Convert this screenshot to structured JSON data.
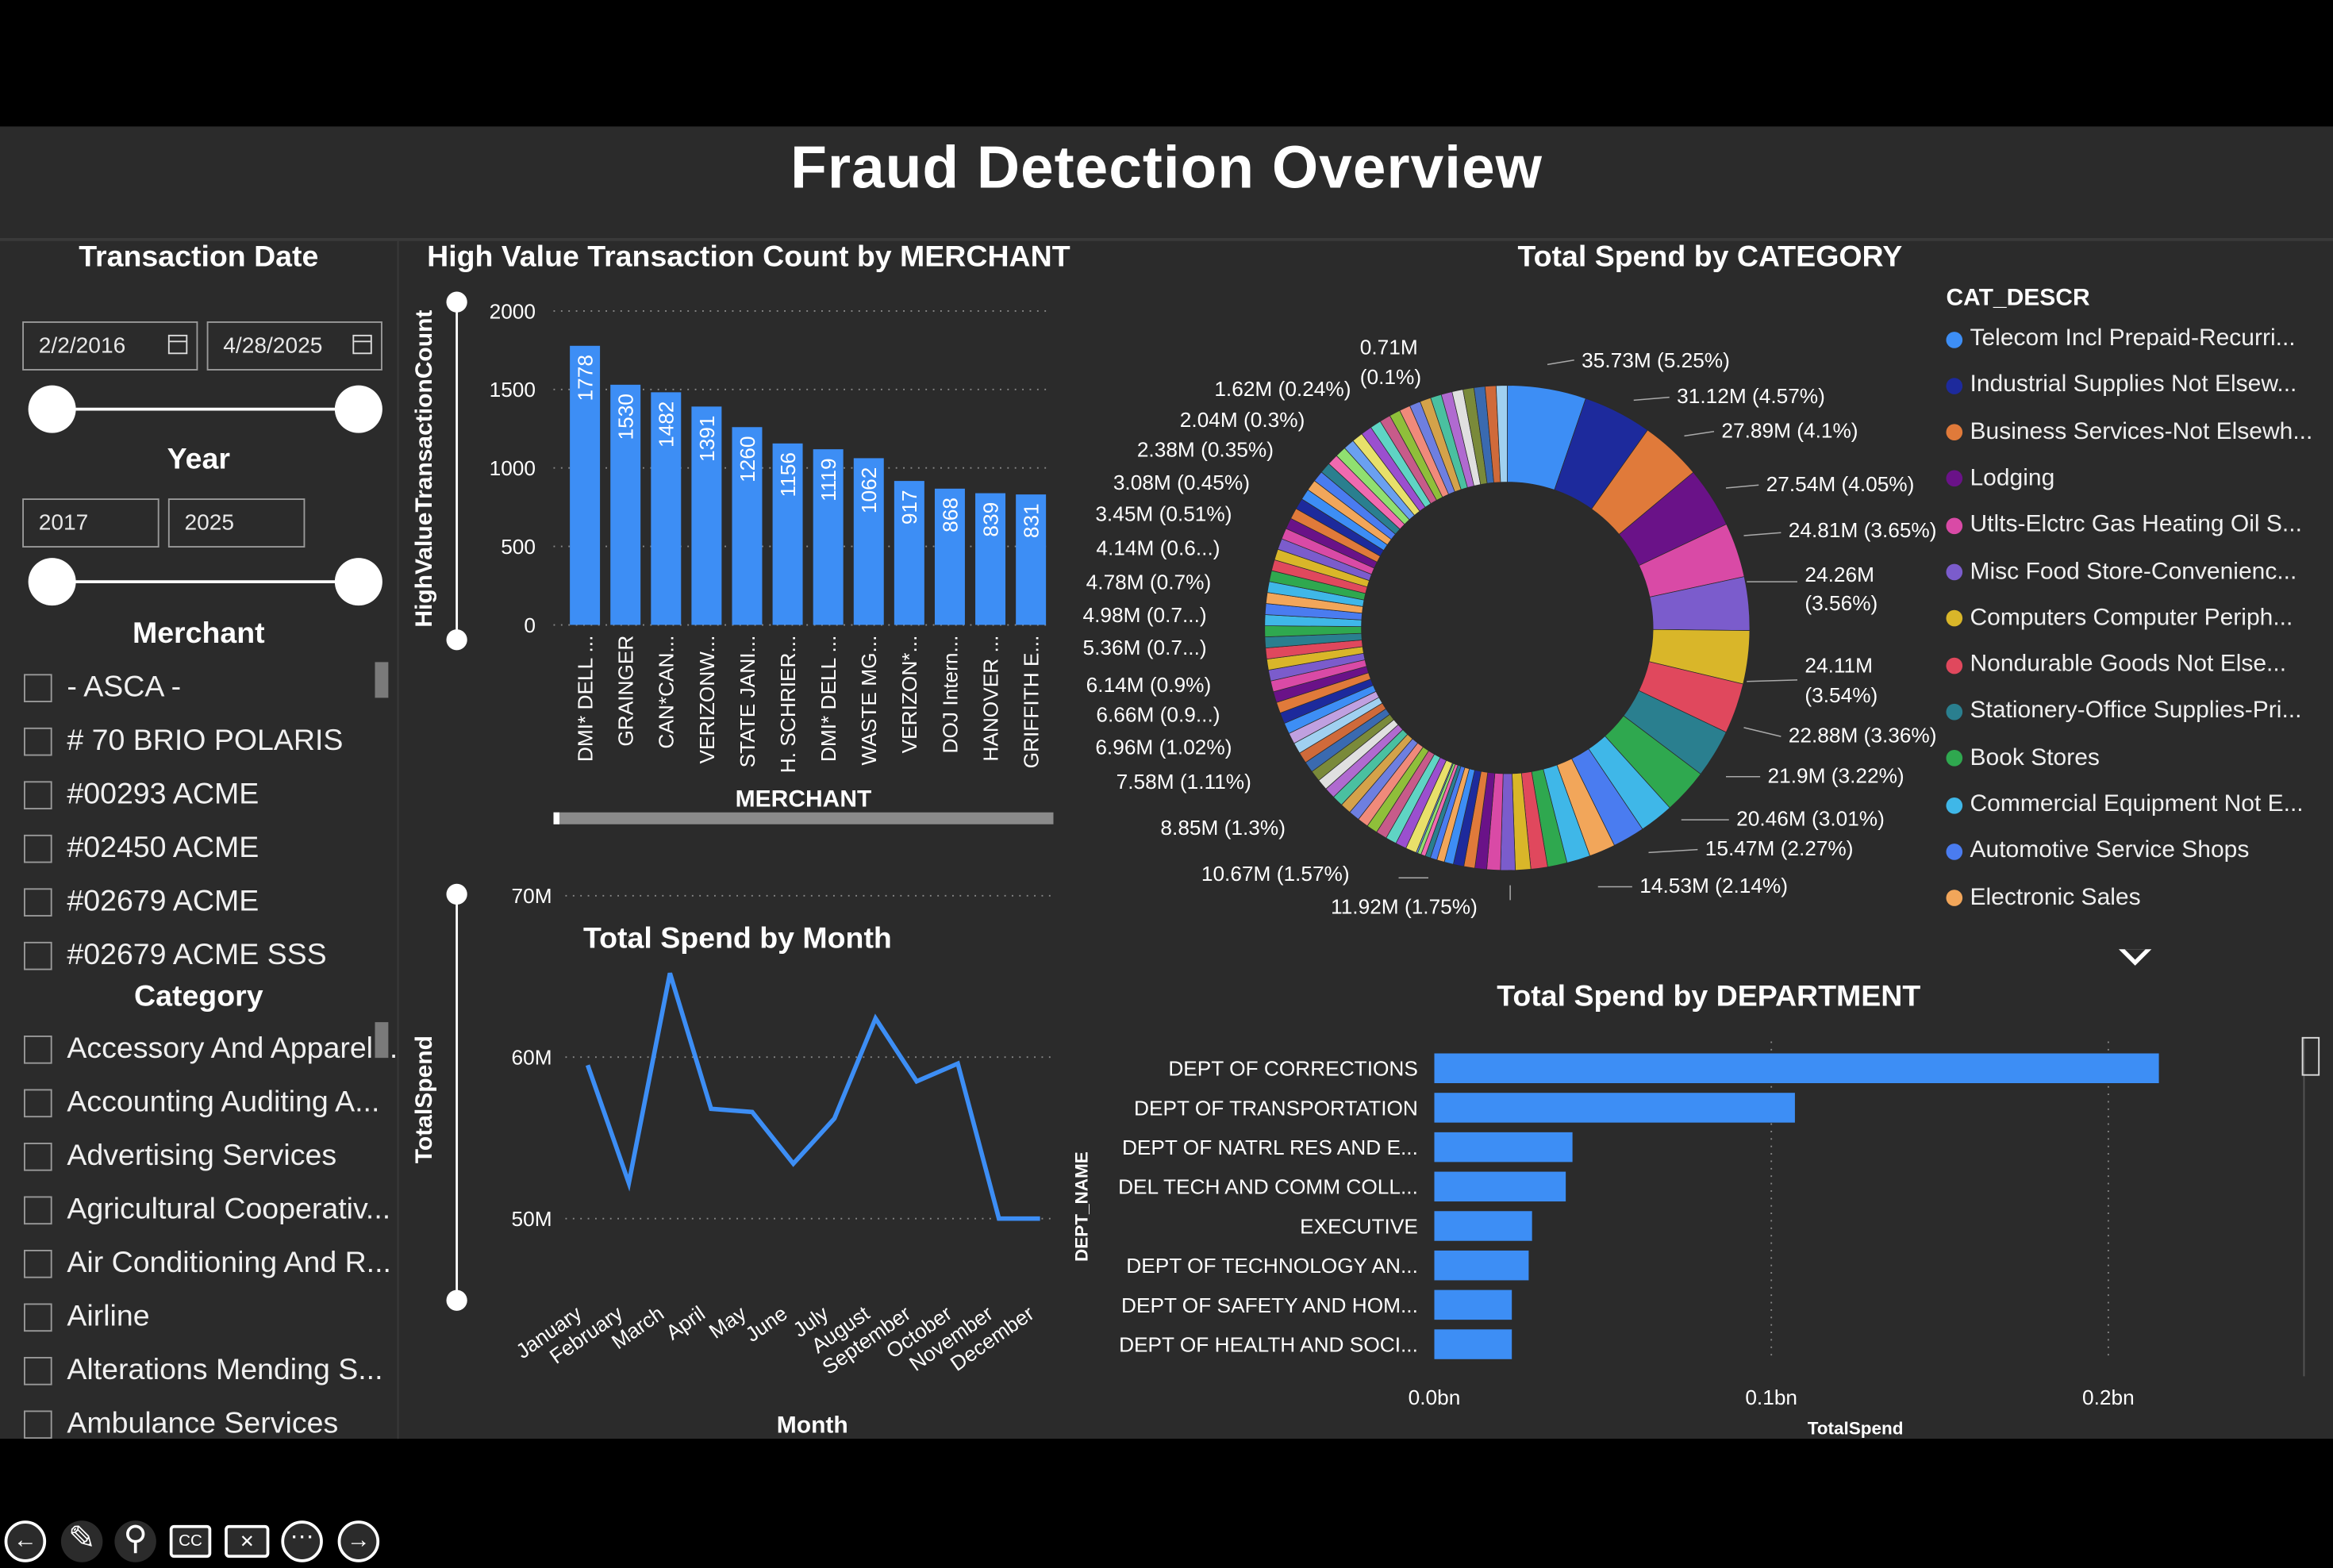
{
  "title": "Fraud Detection Overview",
  "slicers": {
    "transaction_date": {
      "label": "Transaction Date",
      "start": "2/2/2016",
      "end": "4/28/2025"
    },
    "year": {
      "label": "Year",
      "start": "2017",
      "end": "2025"
    },
    "merchant": {
      "label": "Merchant",
      "items": [
        "- ASCA -",
        "# 70 BRIO POLARIS",
        "#00293 ACME",
        "#02450 ACME",
        "#02679 ACME",
        "#02679 ACME SSS"
      ]
    },
    "category": {
      "label": "Category",
      "items": [
        "Accessory And Apparel...",
        "Accounting Auditing A...",
        "Advertising Services",
        "Agricultural Cooperativ...",
        "Air Conditioning And R...",
        "Airline",
        "Alterations Mending S...",
        "Ambulance Services"
      ]
    }
  },
  "colors": {
    "bar": "#3d8ef5",
    "background": "#2b2b2b",
    "frame": "#000000"
  },
  "nav_icons": [
    "back-arrow-icon",
    "pen-icon",
    "zoom-icon",
    "captions-icon",
    "no-video-icon",
    "more-icon",
    "forward-arrow-icon"
  ],
  "charts": {
    "merchant": {
      "title": "High Value Transaction Count by MERCHANT",
      "xlabel": "MERCHANT",
      "ylabel": "HighValueTransactionCount",
      "yticks": [
        "0",
        "500",
        "1000",
        "1500",
        "2000"
      ]
    },
    "month": {
      "title": "Total Spend by Month",
      "xlabel": "Month",
      "ylabel": "TotalSpend",
      "yticks": [
        "50M",
        "60M",
        "70M"
      ]
    },
    "category": {
      "title": "Total Spend by CATEGORY",
      "legend_title": "CAT_DESCR",
      "labels": [
        "35.73M (5.25%)",
        "31.12M (4.57%)",
        "27.89M (4.1%)",
        "27.54M (4.05%)",
        "24.81M (3.65%)",
        "24.26M",
        "(3.56%)",
        "24.11M",
        "(3.54%)",
        "22.88M (3.36%)",
        "21.9M (3.22%)",
        "20.46M (3.01%)",
        "15.47M (2.27%)",
        "14.53M (2.14%)",
        "11.92M (1.75%)",
        "10.67M (1.57%)",
        "8.85M (1.3%)",
        "7.58M (1.11%)",
        "6.96M (1.02%)",
        "6.66M (0.9...)",
        "6.14M (0.9%)",
        "5.36M (0.7...)",
        "4.98M (0.7...)",
        "4.78M (0.7%)",
        "4.14M (0.6...)",
        "3.45M (0.51%)",
        "3.08M (0.45%)",
        "2.38M (0.35%)",
        "2.04M (0.3%)",
        "1.62M (0.24%)",
        "0.71M",
        "(0.1%)"
      ]
    },
    "department": {
      "title": "Total Spend by DEPARTMENT",
      "xlabel": "TotalSpend",
      "ylabel": "DEPT_NAME",
      "xticks": [
        "0.0bn",
        "0.1bn",
        "0.2bn"
      ]
    }
  },
  "chart_data": [
    {
      "type": "bar",
      "categories": [
        "DMI* DELL ...",
        "GRAINGER",
        "CAN*CAN...",
        "VERIZONW...",
        "STATE JANI...",
        "H. SCHRIER...",
        "DMI* DELL ...",
        "WASTE MG...",
        "VERIZON*...",
        "DOJ Intern...",
        "HANOVER ...",
        "GRIFFITH E..."
      ],
      "values": [
        1778,
        1530,
        1482,
        1391,
        1260,
        1156,
        1119,
        1062,
        917,
        868,
        839,
        831
      ],
      "title": "High Value Transaction Count by MERCHANT",
      "xlabel": "MERCHANT",
      "ylabel": "HighValueTransactionCount",
      "ylim": [
        0,
        2000
      ]
    },
    {
      "type": "line",
      "x": [
        "January",
        "February",
        "March",
        "April",
        "May",
        "June",
        "July",
        "August",
        "September",
        "October",
        "November",
        "December"
      ],
      "values": [
        59.5,
        52.2,
        65.2,
        56.8,
        56.6,
        53.4,
        56.2,
        62.4,
        58.5,
        59.6,
        50,
        50
      ],
      "title": "Total Spend by Month",
      "xlabel": "Month",
      "ylabel": "TotalSpend",
      "ylim": [
        48.3,
        71.7
      ]
    },
    {
      "type": "pie",
      "title": "Total Spend by CATEGORY",
      "legend": [
        "Telecom Incl Prepaid-Recurri...",
        "Industrial Supplies Not Elsew...",
        "Business Services-Not Elsewh...",
        "Lodging",
        "Utlts-Elctrc Gas Heating Oil S...",
        "Misc Food Store-Convenienc...",
        "Computers Computer Periph...",
        "Nondurable Goods Not Else...",
        "Stationery-Office Supplies-Pri...",
        "Book Stores",
        "Commercial Equipment Not E...",
        "Automotive Service Shops",
        "Electronic Sales"
      ],
      "colors": [
        "#3d8ef5",
        "#1d2a9c",
        "#e07a3a",
        "#6a1288",
        "#d94aa6",
        "#7b5ccc",
        "#d9b629",
        "#e0485d",
        "#2a7f8f",
        "#2fa84f",
        "#3fb7e8",
        "#4a7cf0",
        "#f2a65a"
      ],
      "values_millions": [
        35.73,
        31.12,
        27.89,
        27.54,
        24.81,
        24.26,
        24.11,
        22.88,
        21.9,
        20.46,
        15.47,
        14.53,
        11.92,
        10.67,
        8.85,
        7.58,
        6.96,
        6.66,
        6.14,
        5.36,
        4.98,
        4.78,
        4.14,
        3.45,
        3.08,
        2.38,
        2.04,
        1.62,
        0.71
      ],
      "percents": [
        5.25,
        4.57,
        4.1,
        4.05,
        3.65,
        3.56,
        3.54,
        3.36,
        3.22,
        3.01,
        2.27,
        2.14,
        1.75,
        1.57,
        1.3,
        1.11,
        1.02,
        0.9,
        0.9,
        0.7,
        0.7,
        0.7,
        0.6,
        0.51,
        0.45,
        0.35,
        0.3,
        0.24,
        0.1
      ]
    },
    {
      "type": "bar",
      "orientation": "horizontal",
      "categories": [
        "DEPT OF CORRECTIONS",
        "DEPT OF TRANSPORTATION",
        "DEPT OF NATRL RES AND E...",
        "DEL TECH AND COMM COLL...",
        "EXECUTIVE",
        "DEPT OF TECHNOLOGY AN...",
        "DEPT OF SAFETY AND HOM...",
        "DEPT OF HEALTH AND SOCI..."
      ],
      "values": [
        0.215,
        0.107,
        0.041,
        0.039,
        0.029,
        0.028,
        0.023,
        0.023
      ],
      "title": "Total Spend by DEPARTMENT",
      "xlabel": "TotalSpend",
      "ylabel": "DEPT_NAME",
      "xlim": [
        0,
        0.22
      ]
    }
  ]
}
